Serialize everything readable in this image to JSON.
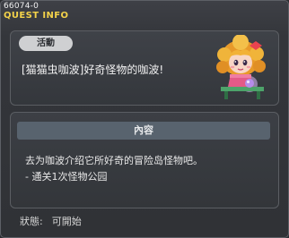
{
  "window": {
    "quest_id": "66074-0",
    "title": "QUEST INFO"
  },
  "quest": {
    "category_badge": "活動",
    "name": "[猫猫虫咖波]好奇怪物的咖波!",
    "npc_image": "npc-portrait"
  },
  "details": {
    "header": "內容",
    "description_line1": "去为咖波介绍它所好奇的冒险岛怪物吧。",
    "description_line2": "- 通关1次怪物公园"
  },
  "status": {
    "label": "狀態:",
    "value": "可開始"
  },
  "colors": {
    "title": "#f3d24a",
    "header_bar": "#58636e",
    "badge": "#cfd0d2"
  }
}
